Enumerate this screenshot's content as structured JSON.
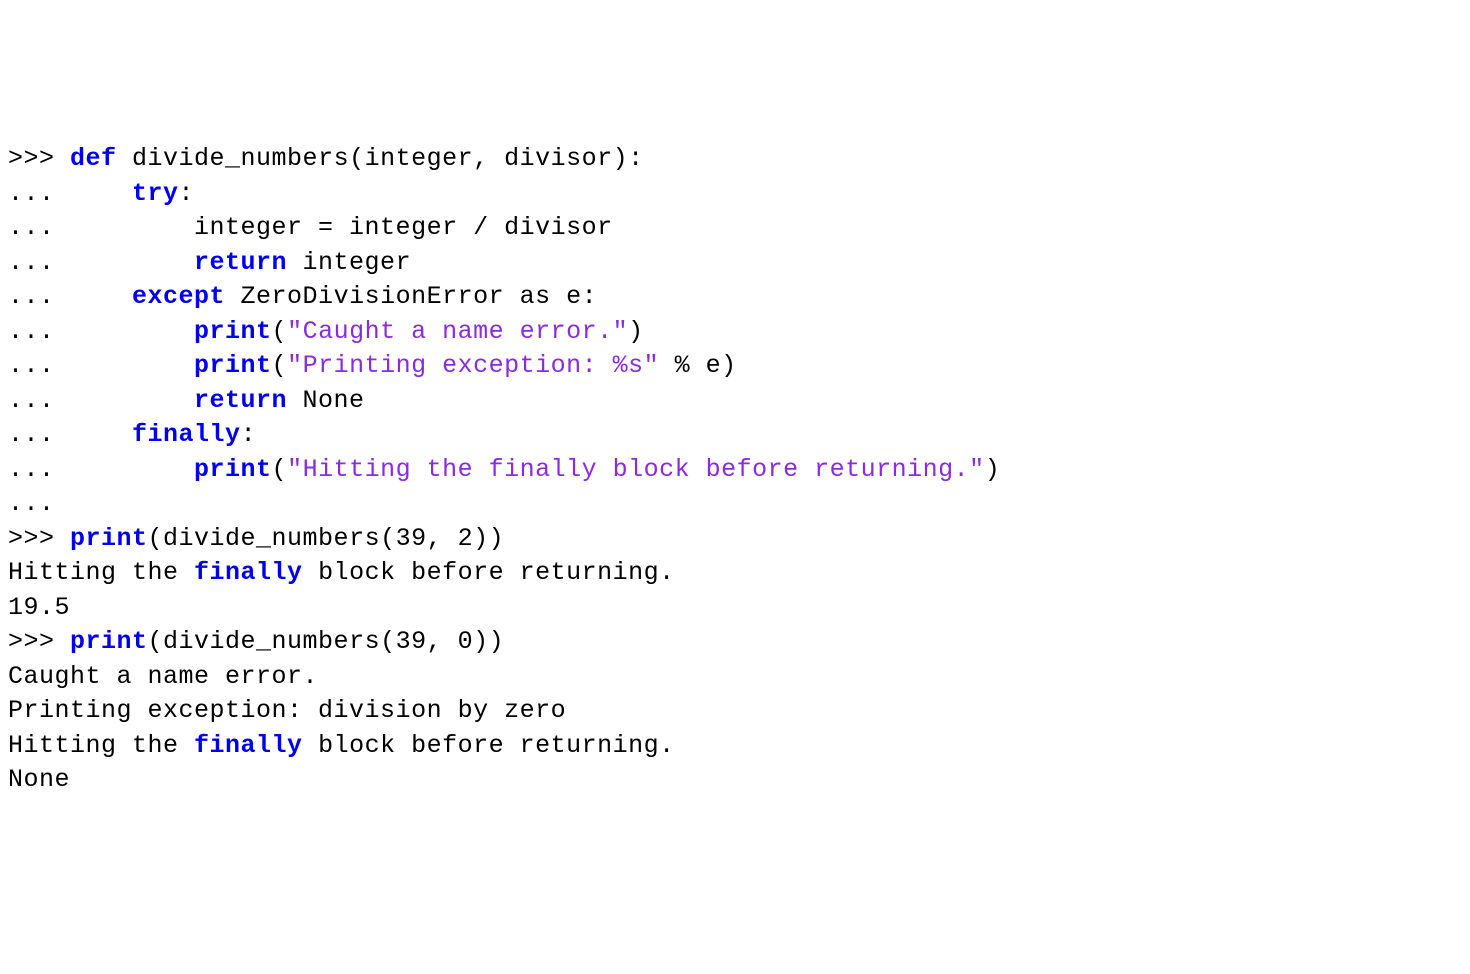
{
  "code": {
    "lines": [
      {
        "segments": [
          {
            "t": ">>> ",
            "c": "prompt"
          },
          {
            "t": "def",
            "c": "kw"
          },
          {
            "t": " divide_numbers(integer, divisor):",
            "c": "plain"
          }
        ]
      },
      {
        "segments": [
          {
            "t": "...     ",
            "c": "prompt"
          },
          {
            "t": "try",
            "c": "kw"
          },
          {
            "t": ":",
            "c": "plain"
          }
        ]
      },
      {
        "segments": [
          {
            "t": "...         integer = integer / divisor",
            "c": "prompt"
          }
        ]
      },
      {
        "segments": [
          {
            "t": "...         ",
            "c": "prompt"
          },
          {
            "t": "return",
            "c": "kw"
          },
          {
            "t": " integer",
            "c": "plain"
          }
        ]
      },
      {
        "segments": [
          {
            "t": "...     ",
            "c": "prompt"
          },
          {
            "t": "except",
            "c": "kw"
          },
          {
            "t": " ZeroDivisionError as e:",
            "c": "plain"
          }
        ]
      },
      {
        "segments": [
          {
            "t": "...         ",
            "c": "prompt"
          },
          {
            "t": "print",
            "c": "kw"
          },
          {
            "t": "(",
            "c": "plain"
          },
          {
            "t": "\"Caught a name error.\"",
            "c": "str"
          },
          {
            "t": ")",
            "c": "plain"
          }
        ]
      },
      {
        "segments": [
          {
            "t": "...         ",
            "c": "prompt"
          },
          {
            "t": "print",
            "c": "kw"
          },
          {
            "t": "(",
            "c": "plain"
          },
          {
            "t": "\"Printing exception: %s\"",
            "c": "str"
          },
          {
            "t": " % e)",
            "c": "plain"
          }
        ]
      },
      {
        "segments": [
          {
            "t": "...         ",
            "c": "prompt"
          },
          {
            "t": "return",
            "c": "kw"
          },
          {
            "t": " None",
            "c": "plain"
          }
        ]
      },
      {
        "segments": [
          {
            "t": "...     ",
            "c": "prompt"
          },
          {
            "t": "finally",
            "c": "kw"
          },
          {
            "t": ":",
            "c": "plain"
          }
        ]
      },
      {
        "segments": [
          {
            "t": "...         ",
            "c": "prompt"
          },
          {
            "t": "print",
            "c": "kw"
          },
          {
            "t": "(",
            "c": "plain"
          },
          {
            "t": "\"Hitting the finally block before returning.\"",
            "c": "str"
          },
          {
            "t": ")",
            "c": "plain"
          }
        ]
      },
      {
        "segments": [
          {
            "t": "...",
            "c": "prompt"
          }
        ]
      },
      {
        "segments": [
          {
            "t": ">>> ",
            "c": "prompt"
          },
          {
            "t": "print",
            "c": "kw"
          },
          {
            "t": "(divide_numbers(39, 2))",
            "c": "plain"
          }
        ]
      },
      {
        "segments": [
          {
            "t": "Hitting the ",
            "c": "plain"
          },
          {
            "t": "finally",
            "c": "kw"
          },
          {
            "t": " block before returning.",
            "c": "plain"
          }
        ]
      },
      {
        "segments": [
          {
            "t": "19.5",
            "c": "plain"
          }
        ]
      },
      {
        "segments": [
          {
            "t": ">>> ",
            "c": "prompt"
          },
          {
            "t": "print",
            "c": "kw"
          },
          {
            "t": "(divide_numbers(39, 0))",
            "c": "plain"
          }
        ]
      },
      {
        "segments": [
          {
            "t": "Caught a name error.",
            "c": "plain"
          }
        ]
      },
      {
        "segments": [
          {
            "t": "Printing exception: division by zero",
            "c": "plain"
          }
        ]
      },
      {
        "segments": [
          {
            "t": "Hitting the ",
            "c": "plain"
          },
          {
            "t": "finally",
            "c": "kw"
          },
          {
            "t": " block before returning.",
            "c": "plain"
          }
        ]
      },
      {
        "segments": [
          {
            "t": "None",
            "c": "plain"
          }
        ]
      }
    ]
  }
}
